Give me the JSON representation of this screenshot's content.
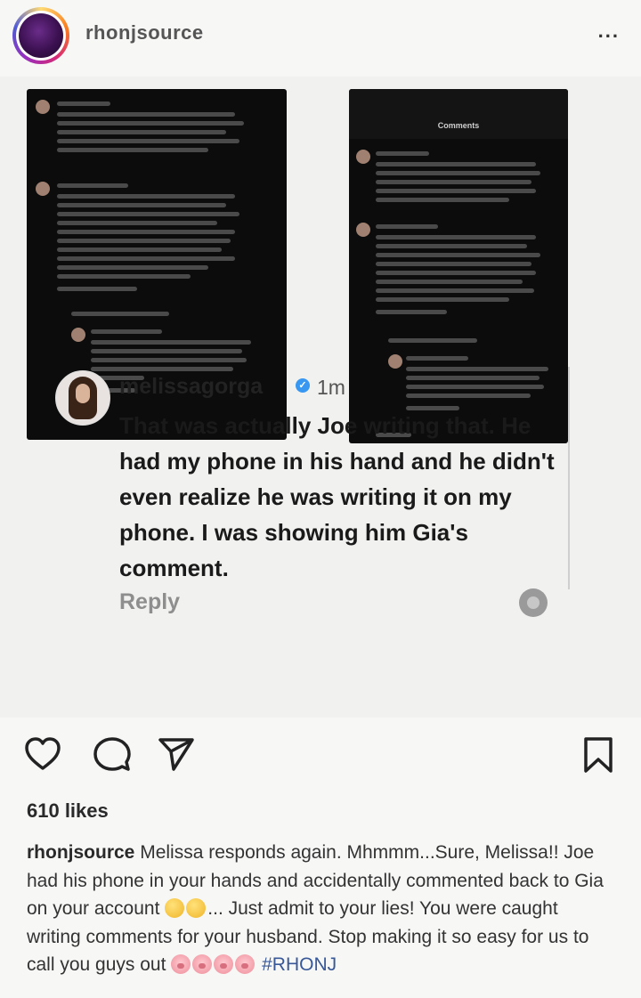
{
  "header": {
    "username": "rhonjsource",
    "more_label": "..."
  },
  "post": {
    "screenshots": [
      {
        "name": "left-screenshot"
      },
      {
        "name": "right-screenshot",
        "title": "Comments"
      }
    ]
  },
  "comment": {
    "username": "melissagorga",
    "time": "1m",
    "text": "That was actually Joe writing that. He had my phone in his hand and he didn't even realize he was writing it on my phone. I was showing him Gia's comment.",
    "reply_label": "Reply"
  },
  "actions": {
    "icons": [
      "heart-icon",
      "comment-icon",
      "share-icon",
      "bookmark-icon"
    ]
  },
  "likes": "610 likes",
  "caption": {
    "username": "rhonjsource",
    "text_1": "Melissa responds again. Mhmmm...Sure, Melissa!! Joe had his phone in your hands and accidentally commented back to Gia on your account",
    "text_2": "... Just admit to your lies! You were caught writing comments for your husband. Stop making it so easy for us to call you guys out",
    "hashtag": "#RHONJ"
  },
  "colors": {
    "background": "#f7f7f6",
    "link": "#385898",
    "verified": "#3897f0"
  }
}
